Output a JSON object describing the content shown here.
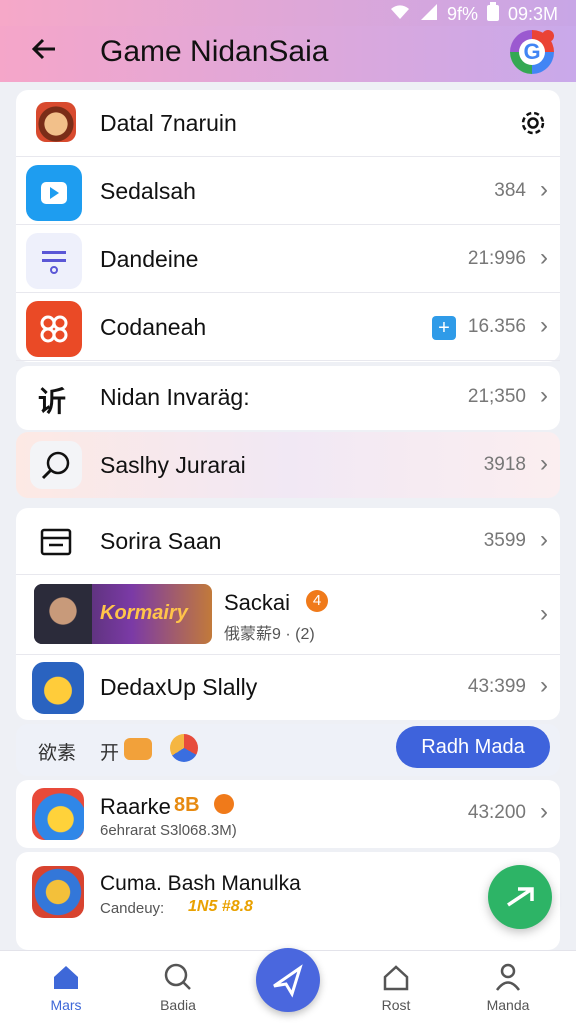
{
  "status": {
    "battery": "9f%",
    "time": "09:3M"
  },
  "header": {
    "title": "Game NidanSaia"
  },
  "rows": [
    {
      "label": "Datal 7naruin",
      "value": ""
    },
    {
      "label": "Sedalsah",
      "value": "384"
    },
    {
      "label": "Dandeine",
      "value": "21:996"
    },
    {
      "label": "Codaneah",
      "value": "16.356"
    },
    {
      "label": "Nidan Invaräg:",
      "value": "21;350"
    },
    {
      "label": "Saslhy Jurarai",
      "value": "3918"
    },
    {
      "label": "Sorira Saan",
      "value": "3599"
    }
  ],
  "banner": {
    "image_text": "Kormairy",
    "title": "Sackai",
    "badge": "4",
    "subtitle": "俄蒙薪9 · (2)"
  },
  "row_dedaxup": {
    "label": "DedaxUp Slally",
    "value": "43:399"
  },
  "filter": {
    "left1": "欲素",
    "left2": "开",
    "button": "Radh Mada"
  },
  "row_raarke": {
    "title": "Raarke",
    "mark": "8B",
    "subtitle": "6ehrarat S3l068.3M)",
    "value": "43:200"
  },
  "row_cuma": {
    "title": "Cuma. Bash Manulka",
    "subtitle": "Candeuy:",
    "subtitle_accent": "1N5 #8.8"
  },
  "nav": [
    {
      "label": "Mars"
    },
    {
      "label": "Badia"
    },
    {
      "label": "Rost"
    },
    {
      "label": "Manda"
    }
  ],
  "colors": {
    "accent": "#3e68d8",
    "fab": "#2db466",
    "header_start": "#f5a6c9",
    "header_end": "#c9a9ea"
  }
}
